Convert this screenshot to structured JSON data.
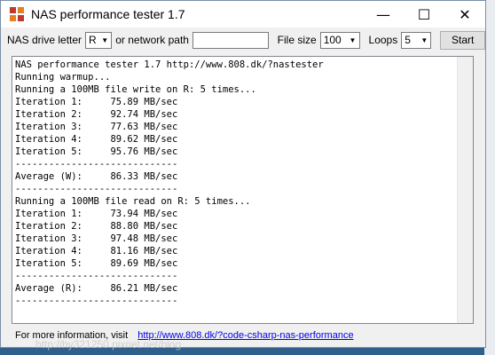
{
  "window": {
    "title": "NAS performance tester 1.7",
    "minimize_glyph": "—",
    "maximize_glyph": "☐",
    "close_glyph": "✕"
  },
  "toolbar": {
    "drive_label": "NAS drive letter",
    "drive_value": "R",
    "network_path_label": "or network path",
    "network_path_value": "",
    "filesize_label": "File size",
    "filesize_value": "100",
    "loops_label": "Loops",
    "loops_value": "5",
    "start_label": "Start",
    "dropdown_arrow": "▼"
  },
  "output_text": "NAS performance tester 1.7 http://www.808.dk/?nastester\nRunning warmup...\nRunning a 100MB file write on R: 5 times...\nIteration 1:     75.89 MB/sec\nIteration 2:     92.74 MB/sec\nIteration 3:     77.63 MB/sec\nIteration 4:     89.62 MB/sec\nIteration 5:     95.76 MB/sec\n-----------------------------\nAverage (W):     86.33 MB/sec\n-----------------------------\nRunning a 100MB file read on R: 5 times...\nIteration 1:     73.94 MB/sec\nIteration 2:     88.80 MB/sec\nIteration 3:     97.48 MB/sec\nIteration 4:     81.16 MB/sec\nIteration 5:     89.69 MB/sec\n-----------------------------\nAverage (R):     86.21 MB/sec\n-----------------------------",
  "footer": {
    "text": "For more information, visit",
    "link": "http://www.808.dk/?code-csharp-nas-performance"
  },
  "watermark": "http://hy321250.pixnet.net/blog",
  "colors": {
    "desktop": "#2f5f8a",
    "link": "#0000ee"
  }
}
